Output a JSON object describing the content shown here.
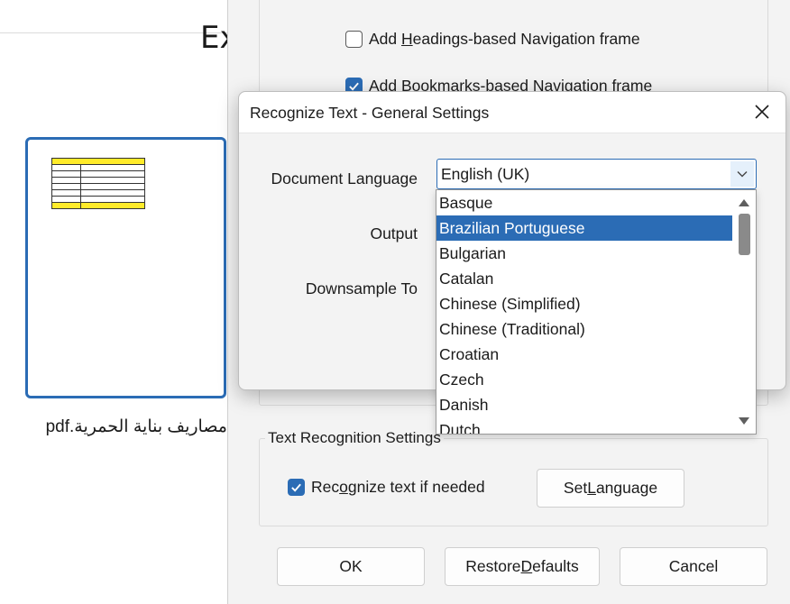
{
  "left_pane": {
    "partial_heading": "Ex",
    "thumbnail_name": "مصاريف بناية الحمرية.pdf"
  },
  "export_dialog": {
    "options": {
      "headings_nav_pre": "Add ",
      "headings_nav_key": "H",
      "headings_nav_post": "eadings-based Navigation frame",
      "headings_nav_checked": false,
      "bookmarks_nav_label": "Add Bookmarks-based Navigation frame",
      "bookmarks_nav_checked": true
    },
    "text_recognition": {
      "group_label": "Text Recognition Settings",
      "recognize_pre": "Rec",
      "recognize_key": "o",
      "recognize_post": "gnize text if needed",
      "recognize_checked": true,
      "set_language_pre": "Set ",
      "set_language_key": "L",
      "set_language_post": "anguage"
    },
    "buttons": {
      "ok": "OK",
      "restore_pre": "Restore ",
      "restore_key": "D",
      "restore_post": "efaults",
      "cancel": "Cancel"
    }
  },
  "modal": {
    "title": "Recognize Text - General Settings",
    "close_icon": "close-icon",
    "labels": {
      "document_language": "Document Language",
      "output": "Output",
      "downsample_to": "Downsample To"
    },
    "document_language_value": "English (UK)",
    "language_options": [
      "Basque",
      "Brazilian Portuguese",
      "Bulgarian",
      "Catalan",
      "Chinese (Simplified)",
      "Chinese (Traditional)",
      "Croatian",
      "Czech",
      "Danish",
      "Dutch"
    ],
    "highlighted_option": "Brazilian Portuguese"
  },
  "colors": {
    "accent": "#2b6cb5",
    "dialog_bg": "#f3f3f3",
    "thumb_highlight": "#ffeb2a"
  }
}
